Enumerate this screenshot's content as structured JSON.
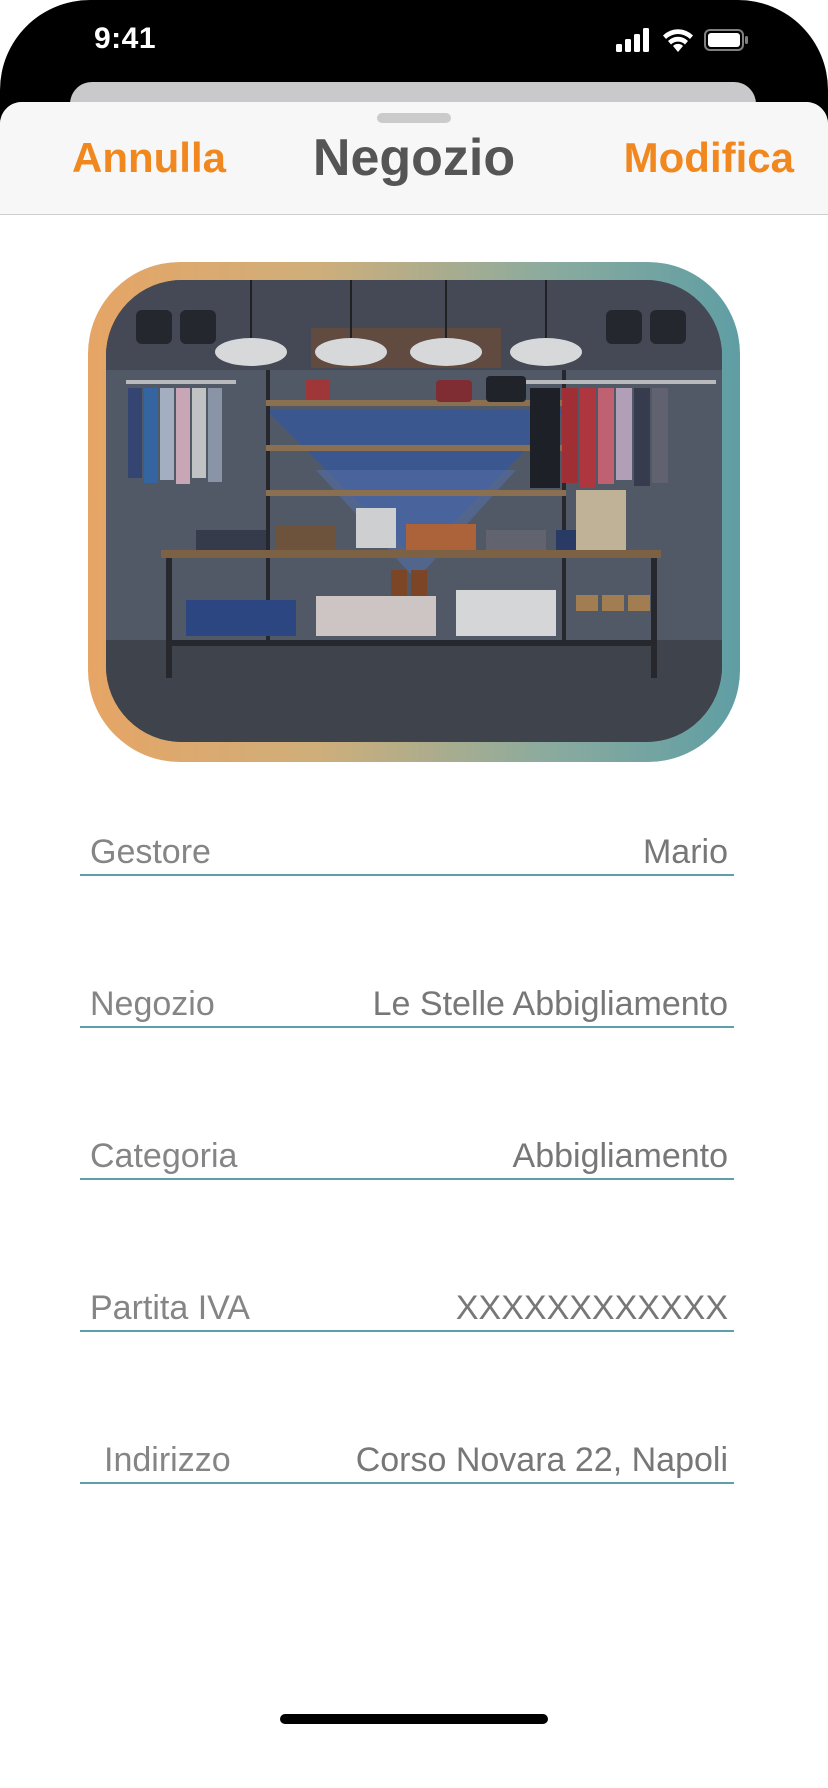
{
  "status_bar": {
    "time": "9:41",
    "icons": [
      "cellular-signal-icon",
      "wifi-icon",
      "battery-icon"
    ]
  },
  "nav": {
    "cancel_label": "Annulla",
    "title": "Negozio",
    "edit_label": "Modifica"
  },
  "colors": {
    "accent": "#f0881f",
    "divider": "#5ea0a7",
    "frame_gradient_start": "#e6a565",
    "frame_gradient_end": "#5f9ea4"
  },
  "store_photo": {
    "icon": "store-interior-photo"
  },
  "fields": [
    {
      "label": "Gestore",
      "value": "Mario"
    },
    {
      "label": "Negozio",
      "value": "Le Stelle Abbigliamento"
    },
    {
      "label": "Categoria",
      "value": "Abbigliamento"
    },
    {
      "label": "Partita IVA",
      "value": "XXXXXXXXXXXX"
    },
    {
      "label": "Indirizzo",
      "value": "Corso Novara 22, Napoli"
    }
  ]
}
